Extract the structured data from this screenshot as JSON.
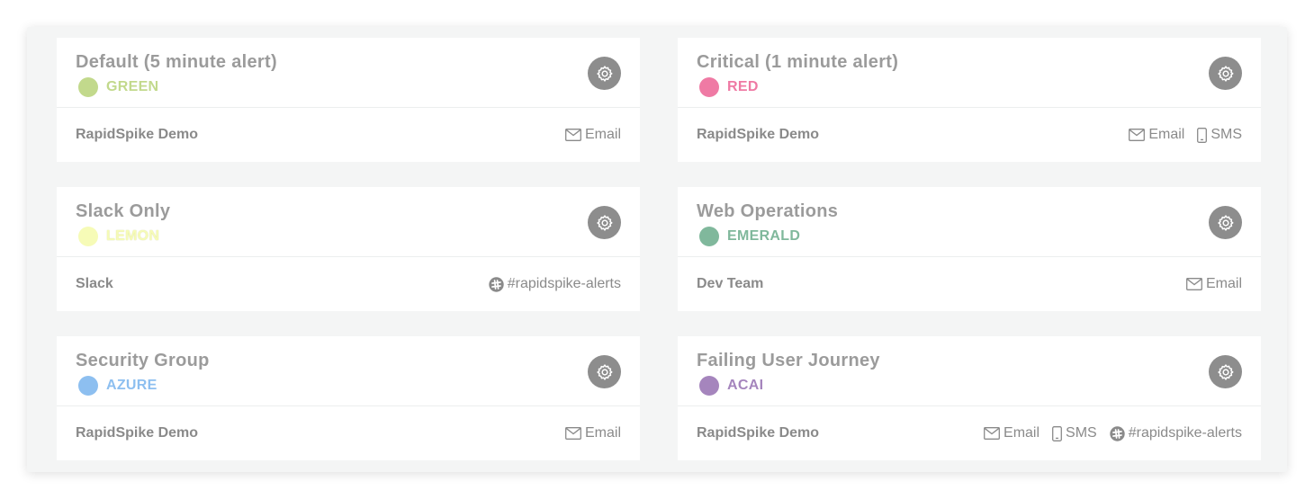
{
  "cards": [
    {
      "title": "Default (5 minute alert)",
      "color_name": "GREEN",
      "color": "#c2d98c",
      "team": "RapidSpike Demo",
      "channels": [
        {
          "type": "email",
          "label": "Email"
        }
      ]
    },
    {
      "title": "Critical (1 minute alert)",
      "color_name": "RED",
      "color": "#ef7aa4",
      "team": "RapidSpike Demo",
      "channels": [
        {
          "type": "email",
          "label": "Email"
        },
        {
          "type": "sms",
          "label": "SMS"
        }
      ]
    },
    {
      "title": "Slack Only",
      "color_name": "LEMON",
      "color": "#f6fbb7",
      "team": "Slack",
      "channels": [
        {
          "type": "slack",
          "label": "#rapidspike-alerts"
        }
      ]
    },
    {
      "title": "Web Operations",
      "color_name": "EMERALD",
      "color": "#80b89c",
      "team": "Dev Team",
      "channels": [
        {
          "type": "email",
          "label": "Email"
        }
      ]
    },
    {
      "title": "Security Group",
      "color_name": "AZURE",
      "color": "#8dbff0",
      "team": "RapidSpike Demo",
      "channels": [
        {
          "type": "email",
          "label": "Email"
        }
      ]
    },
    {
      "title": "Failing User Journey",
      "color_name": "ACAI",
      "color": "#a585bd",
      "team": "RapidSpike Demo",
      "channels": [
        {
          "type": "email",
          "label": "Email"
        },
        {
          "type": "sms",
          "label": "SMS"
        },
        {
          "type": "slack",
          "label": "#rapidspike-alerts"
        }
      ]
    }
  ],
  "icons": {
    "settings": "gear-icon",
    "email": "envelope-icon",
    "sms": "mobile-phone-icon",
    "slack": "slack-icon"
  },
  "colors": {
    "text_muted": "#9b9b9b",
    "gear_bg": "#8d8d8d",
    "panel_bg": "#f4f5f5"
  }
}
